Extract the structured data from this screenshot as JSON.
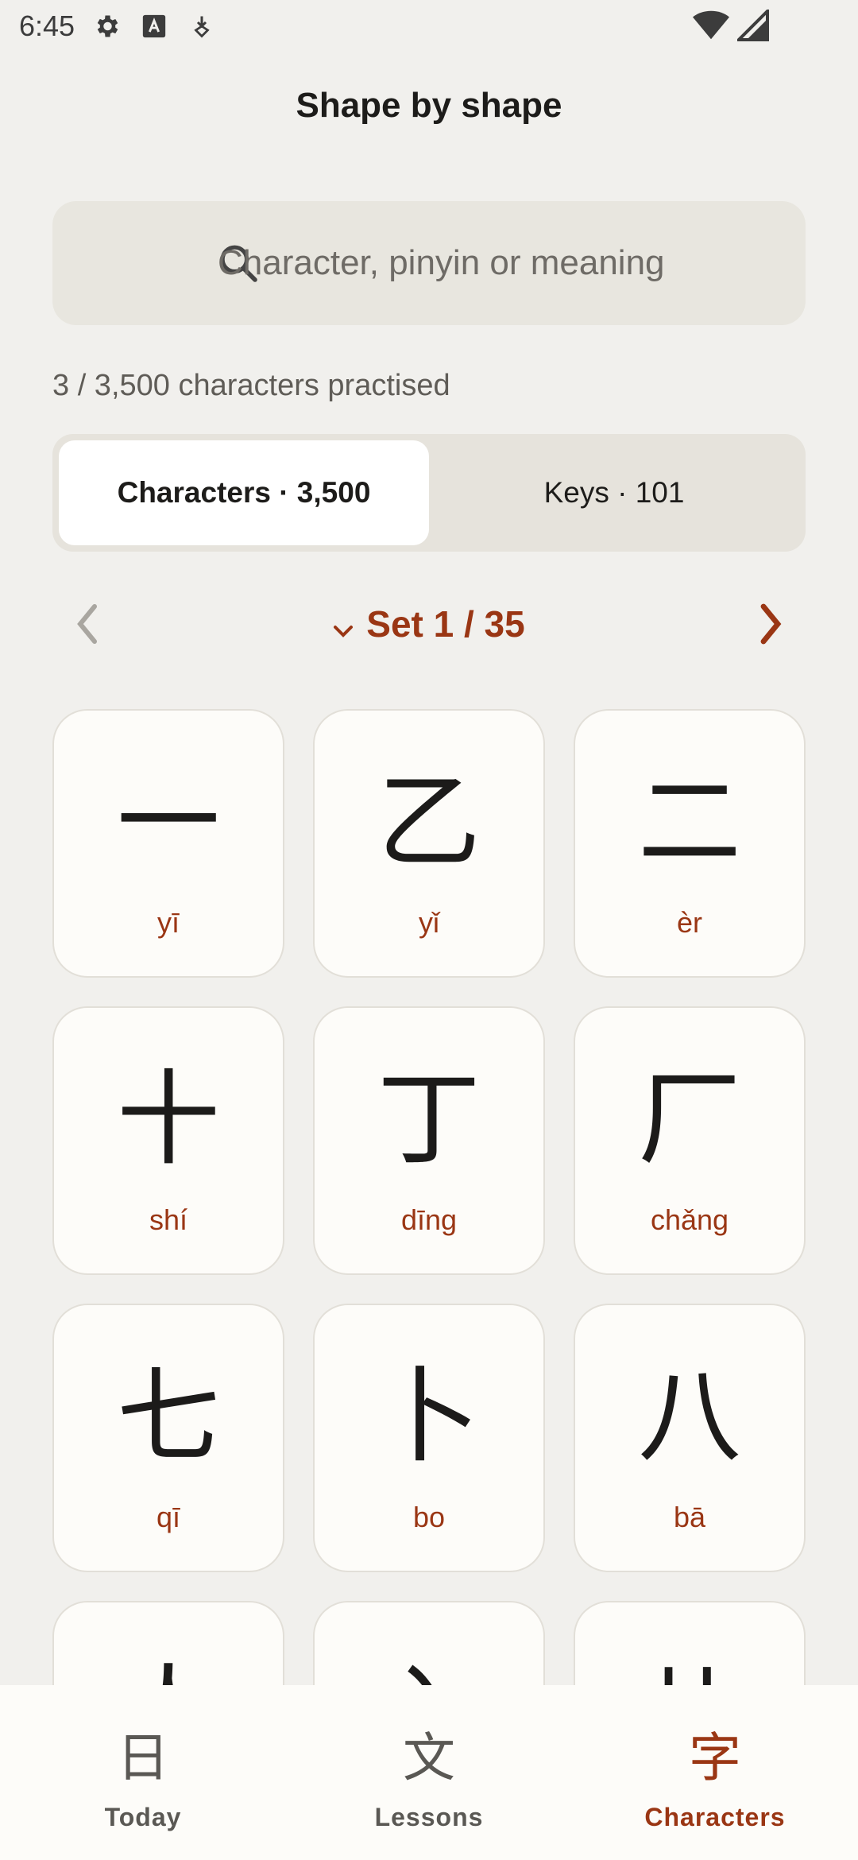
{
  "status_bar": {
    "time": "6:45",
    "icons": [
      "settings-icon",
      "text-a-icon",
      "download-icon"
    ],
    "right_icons": [
      "wifi-icon",
      "signal-icon"
    ]
  },
  "header": {
    "title": "Shape by shape"
  },
  "search": {
    "placeholder": "Character, pinyin or meaning",
    "value": ""
  },
  "progress": {
    "text": "3 / 3,500 characters practised"
  },
  "segments": [
    {
      "label": "Characters · 3,500",
      "active": true
    },
    {
      "label": "Keys · 101",
      "active": false
    }
  ],
  "set_nav": {
    "label": "Set 1 / 35",
    "dropdown_icon": "chevron-down-icon"
  },
  "cards": [
    {
      "char": "一",
      "pinyin": "yī"
    },
    {
      "char": "乙",
      "pinyin": "yǐ"
    },
    {
      "char": "二",
      "pinyin": "èr"
    },
    {
      "char": "十",
      "pinyin": "shí"
    },
    {
      "char": "丁",
      "pinyin": "dīng"
    },
    {
      "char": "厂",
      "pinyin": "chǎng"
    },
    {
      "char": "七",
      "pinyin": "qī"
    },
    {
      "char": "卜",
      "pinyin": "bo"
    },
    {
      "char": "八",
      "pinyin": "bā"
    },
    {
      "char": "人",
      "pinyin": ""
    },
    {
      "char": "入",
      "pinyin": ""
    },
    {
      "char": "儿",
      "pinyin": ""
    }
  ],
  "bottom_nav": [
    {
      "glyph": "日",
      "label": "Today",
      "active": false
    },
    {
      "glyph": "文",
      "label": "Lessons",
      "active": false
    },
    {
      "glyph": "字",
      "label": "Characters",
      "active": true
    }
  ],
  "colors": {
    "accent": "#9a3614",
    "background": "#f1f0ed",
    "card": "#fdfcf9"
  }
}
